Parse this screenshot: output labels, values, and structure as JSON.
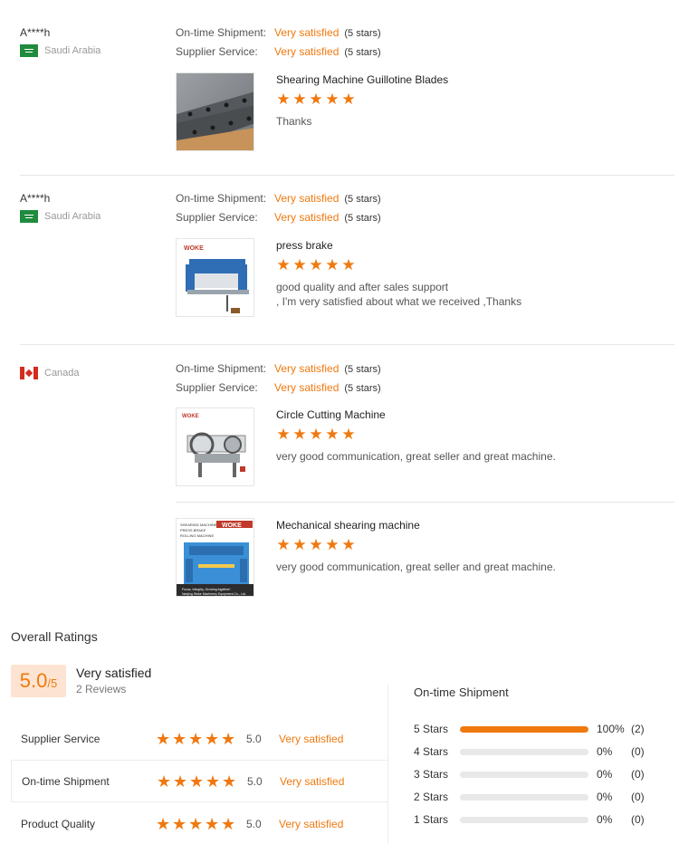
{
  "reviews": [
    {
      "buyer": "A****h",
      "country": "Saudi Arabia",
      "flag_icon": "saudi-arabia-flag-icon",
      "ontime_label": "On-time Shipment:",
      "ontime_value": "Very satisfied",
      "ontime_stars": "(5 stars)",
      "service_label": "Supplier Service:",
      "service_value": "Very satisfied",
      "service_stars": "(5 stars)",
      "products": [
        {
          "name": "Shearing Machine Guillotine Blades",
          "rating": 5,
          "comment": [
            "Thanks"
          ]
        }
      ]
    },
    {
      "buyer": "A****h",
      "country": "Saudi Arabia",
      "flag_icon": "saudi-arabia-flag-icon",
      "ontime_label": "On-time Shipment:",
      "ontime_value": "Very satisfied",
      "ontime_stars": "(5 stars)",
      "service_label": "Supplier Service:",
      "service_value": "Very satisfied",
      "service_stars": "(5 stars)",
      "products": [
        {
          "name": "press brake",
          "rating": 5,
          "image_text": "WOKE MACHINERY",
          "comment": [
            "good quality and after sales support",
            ", I'm very satisfied about what we received ,Thanks"
          ]
        }
      ]
    },
    {
      "buyer": "",
      "country": "Canada",
      "flag_icon": "canada-flag-icon",
      "ontime_label": "On-time Shipment:",
      "ontime_value": "Very satisfied",
      "ontime_stars": "(5 stars)",
      "service_label": "Supplier Service:",
      "service_value": "Very satisfied",
      "service_stars": "(5 stars)",
      "products": [
        {
          "name": "Circle Cutting Machine",
          "rating": 5,
          "image_text": "WOKE",
          "comment": [
            "very good communication, great seller and great machine."
          ]
        },
        {
          "name": "Mechanical shearing machine",
          "rating": 5,
          "image_text": "WOKE MACHINERY",
          "comment": [
            "very good communication, great seller and great machine."
          ]
        }
      ]
    }
  ],
  "overall": {
    "title": "Overall Ratings",
    "score": "5.0",
    "score_out_of": "/5",
    "label": "Very satisfied",
    "reviews_count": "2 Reviews",
    "categories": [
      {
        "name": "Supplier Service",
        "rating": 5,
        "score": "5.0",
        "label": "Very satisfied"
      },
      {
        "name": "On-time Shipment",
        "rating": 5,
        "score": "5.0",
        "label": "Very satisfied"
      },
      {
        "name": "Product Quality",
        "rating": 5,
        "score": "5.0",
        "label": "Very satisfied"
      }
    ],
    "distribution_title": "On-time Shipment",
    "distribution": [
      {
        "label": "5 Stars",
        "fraction": 1.0,
        "pct": "100%",
        "count": "(2)"
      },
      {
        "label": "4 Stars",
        "fraction": 0,
        "pct": "0%",
        "count": "(0)"
      },
      {
        "label": "3 Stars",
        "fraction": 0,
        "pct": "0%",
        "count": "(0)"
      },
      {
        "label": "2 Stars",
        "fraction": 0,
        "pct": "0%",
        "count": "(0)"
      },
      {
        "label": "1 Stars",
        "fraction": 0,
        "pct": "0%",
        "count": "(0)"
      }
    ],
    "accent_color": "#f0790f"
  }
}
